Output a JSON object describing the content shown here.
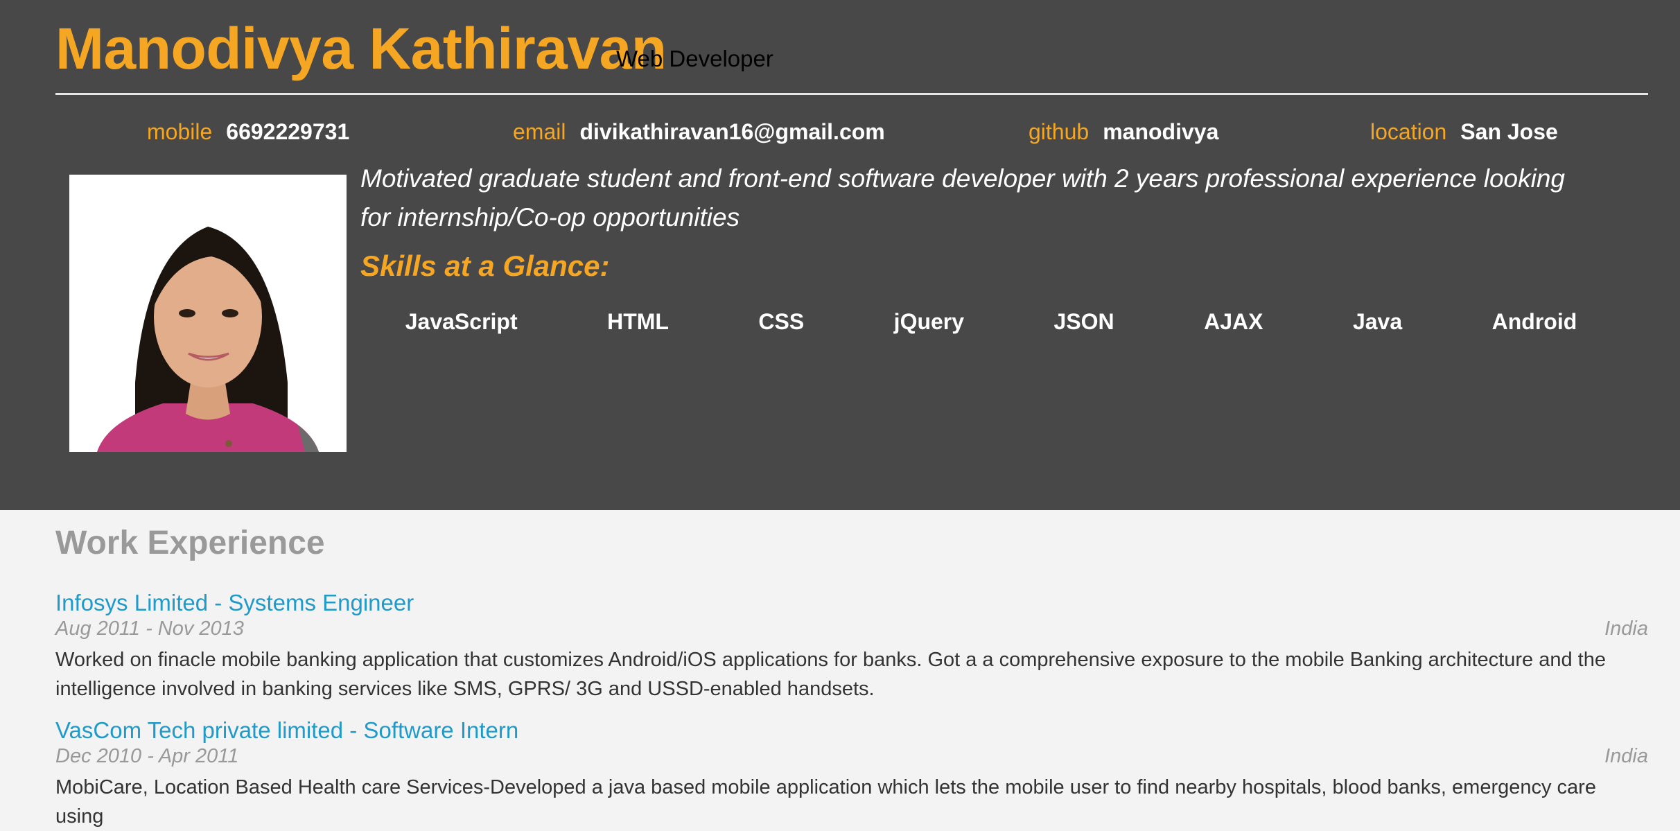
{
  "header": {
    "name": "Manodivya Kathiravan",
    "role": "Web Developer",
    "contacts": [
      {
        "label": "mobile",
        "value": "6692229731"
      },
      {
        "label": "email",
        "value": "divikathiravan16@gmail.com"
      },
      {
        "label": "github",
        "value": "manodivya"
      },
      {
        "label": "location",
        "value": "San Jose"
      }
    ],
    "bio": "Motivated graduate student and front-end software developer with 2 years professional experience looking for internship/Co-op opportunities",
    "skills_title": "Skills at a Glance:",
    "skills": [
      "JavaScript",
      "HTML",
      "CSS",
      "jQuery",
      "JSON",
      "AJAX",
      "Java",
      "Android"
    ]
  },
  "work": {
    "title": "Work Experience",
    "jobs": [
      {
        "title": "Infosys Limited - Systems Engineer",
        "dates": "Aug 2011 - Nov 2013",
        "location": "India",
        "description": "Worked on finacle mobile banking application that customizes Android/iOS applications for banks. Got a a comprehensive exposure to the mobile Banking architecture and the intelligence involved in banking services like SMS, GPRS/ 3G and USSD-enabled handsets."
      },
      {
        "title": "VasCom Tech private limited - Software Intern",
        "dates": "Dec 2010 - Apr 2011",
        "location": "India",
        "description": "MobiCare, Location Based Health care Services-Developed a java based mobile application which lets the mobile user to find nearby hospitals, blood banks, emergency care using"
      }
    ]
  },
  "colors": {
    "accent": "#f5a623",
    "header_bg": "#484848",
    "page_bg": "#f3f3f3",
    "link": "#1f9ac9"
  }
}
